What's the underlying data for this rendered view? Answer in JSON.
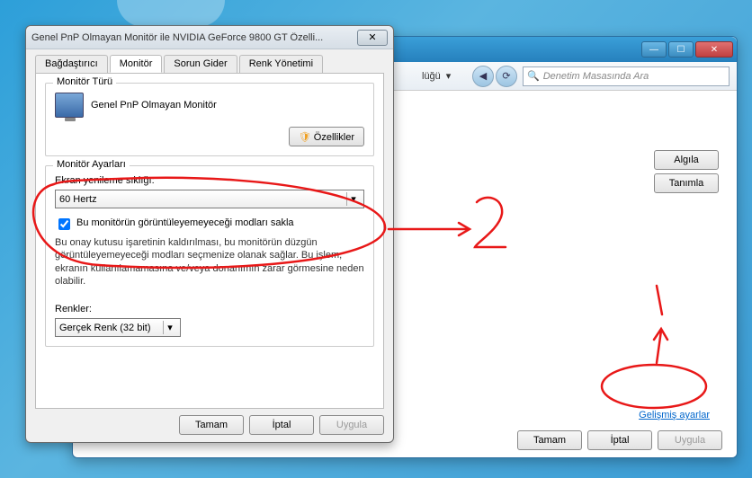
{
  "controlPanel": {
    "breadcrumb_suffix": "lüğü",
    "nav_back": "◀",
    "nav_fwd": "▶",
    "refresh": "⟳",
    "search_placeholder": "Denetim Masasında Ara",
    "detect_btn": "Algıla",
    "identify_btn": "Tanımla",
    "advanced_link": "Gelişmiş ayarlar",
    "ok": "Tamam",
    "cancel": "İptal",
    "apply": "Uygula",
    "min": "—",
    "max": "☐",
    "close": "✕"
  },
  "dialog": {
    "title": "Genel PnP Olmayan Monitör ile NVIDIA GeForce 9800 GT   Özelli...",
    "close": "✕",
    "tabs": {
      "adapter": "Bağdaştırıcı",
      "monitor": "Monitör",
      "troubleshoot": "Sorun Gider",
      "colormgmt": "Renk Yönetimi"
    },
    "monitor_type_group": "Monitör Türü",
    "monitor_name": "Genel PnP Olmayan Monitör",
    "properties_btn": "Özellikler",
    "monitor_settings_group": "Monitör Ayarları",
    "refresh_label": "Ekran yenileme sıklığı:",
    "refresh_value": "60 Hertz",
    "hide_modes_checkbox": "Bu monitörün görüntüleyemeyeceği modları sakla",
    "hide_modes_hint": "Bu onay kutusu işaretinin kaldırılması, bu monitörün düzgün görüntüleyemeyeceği modları seçmenize olanak sağlar. Bu işlem, ekranın kullanılamamasına ve/veya donanımın zarar görmesine neden olabilir.",
    "colors_label": "Renkler:",
    "colors_value": "Gerçek Renk (32 bit)",
    "ok": "Tamam",
    "cancel": "İptal",
    "apply": "Uygula",
    "dropdown_arrow": "▾"
  },
  "annotations": {
    "num1": "1",
    "num2": "2"
  }
}
